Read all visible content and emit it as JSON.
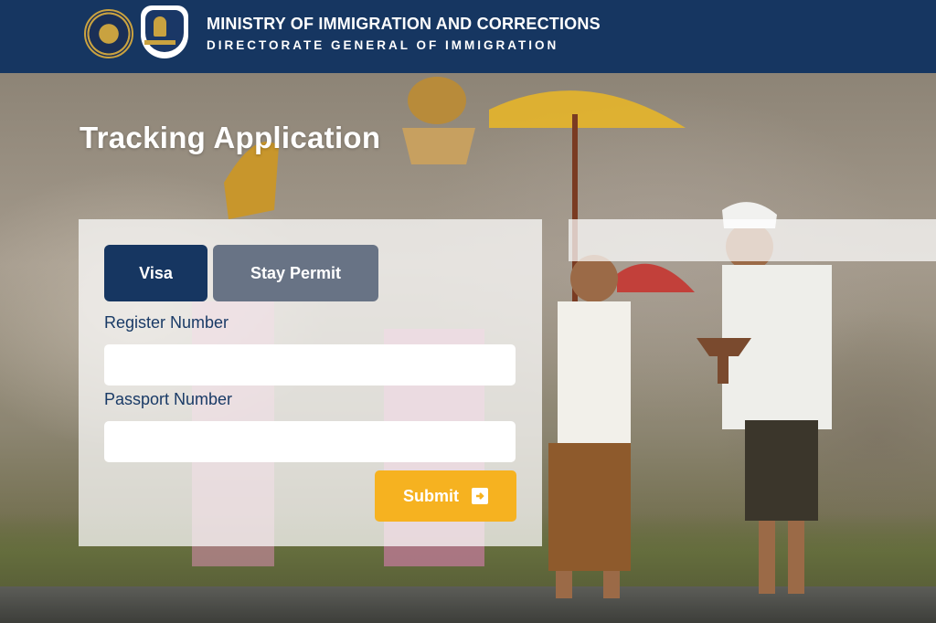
{
  "header": {
    "title": "MINISTRY OF IMMIGRATION AND CORRECTIONS",
    "subtitle": "DIRECTORATE GENERAL OF IMMIGRATION",
    "logos": [
      "ministry-emblem-icon",
      "immigration-emblem-icon"
    ]
  },
  "page": {
    "title": "Tracking Application"
  },
  "form": {
    "tabs": [
      {
        "label": "Visa",
        "active": true
      },
      {
        "label": "Stay Permit",
        "active": false
      }
    ],
    "register_label": "Register Number",
    "register_value": "",
    "passport_label": "Passport Number",
    "passport_value": "",
    "submit_label": "Submit",
    "submit_icon": "arrow-right-square-icon"
  },
  "colors": {
    "header_bg": "#163661",
    "tab_active": "#163661",
    "tab_inactive": "#687385",
    "submit": "#f6b220",
    "label_text": "#193a66"
  }
}
